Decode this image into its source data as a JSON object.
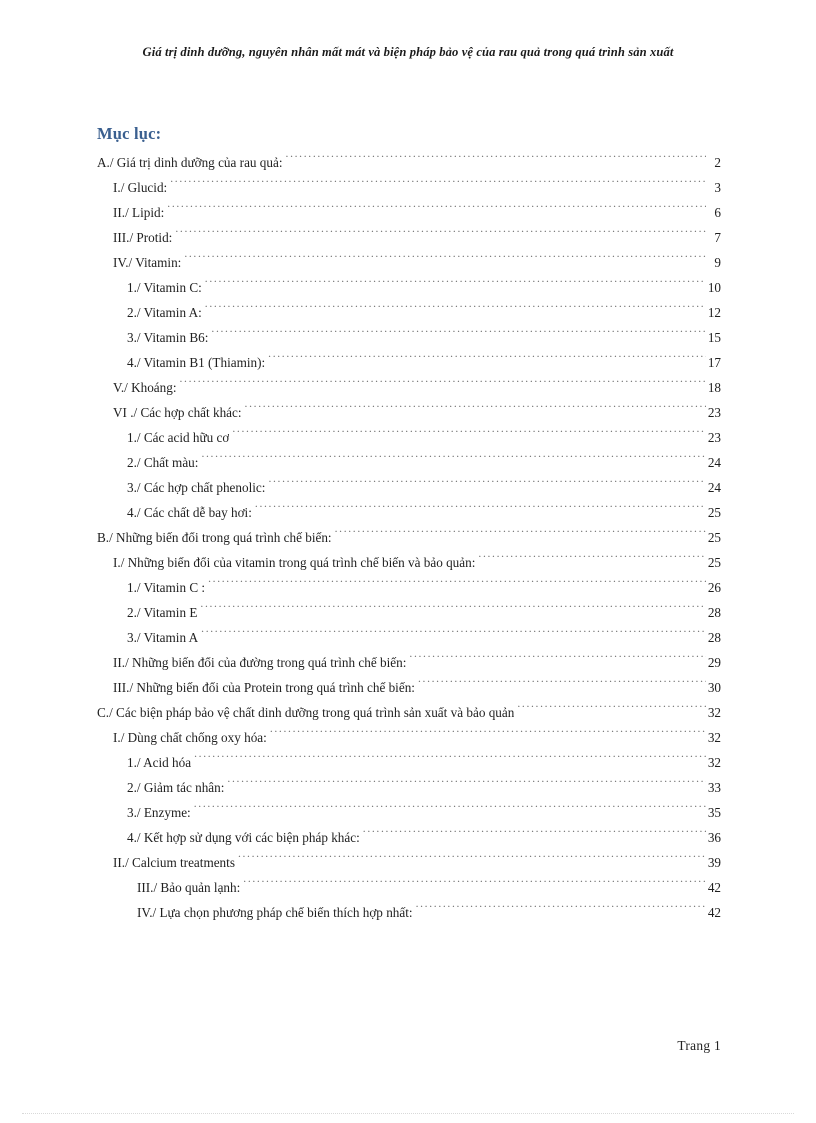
{
  "header": {
    "running_title": "Giá trị dinh dưỡng, nguyên nhân mất mát và biện pháp bảo vệ của rau quả trong quá trình sản xuất"
  },
  "toc": {
    "title": "Mục lục:",
    "entries": [
      {
        "level": 0,
        "label": "A./ Giá trị dinh  dưỡng của rau  quả:",
        "page": "2"
      },
      {
        "level": 1,
        "label": "I./ Glucid:",
        "page": "3"
      },
      {
        "level": 1,
        "label": "II./  Lipid:",
        "page": "6"
      },
      {
        "level": 1,
        "label": "III./ Protid:",
        "page": "7"
      },
      {
        "level": 1,
        "label": "IV./ Vitamin:",
        "page": "9"
      },
      {
        "level": 2,
        "label": "1./ Vitamin  C:",
        "page": "10"
      },
      {
        "level": 2,
        "label": "2./ Vitamin  A:",
        "page": "12"
      },
      {
        "level": 2,
        "label": "3./ Vitamin  B6:",
        "page": "15"
      },
      {
        "level": 2,
        "label": "4./ Vitamin  B1 (Thiamin):",
        "page": "17"
      },
      {
        "level": 1,
        "label": "V./ Khoáng:",
        "page": "18"
      },
      {
        "level": 1,
        "label": "VI ./ Các hợp  chất khác:",
        "page": "23"
      },
      {
        "level": 2,
        "label": "1./ Các acid hữu cơ",
        "page": "23"
      },
      {
        "level": 2,
        "label": "2./ Chất màu:",
        "page": "24"
      },
      {
        "level": 2,
        "label": "3./ Các hợp  chất phenolic:",
        "page": "24"
      },
      {
        "level": 2,
        "label": "4./ Các chất dễ bay hơi:",
        "page": "25"
      },
      {
        "level": 0,
        "label": "B./ Những biến  đổi trong  quá trình  chế biến:",
        "page": "25"
      },
      {
        "level": 1,
        "label": "I./ Những biến  đổi của vitamin  trong  quá trình  chế biến  và bảo quản:",
        "page": "25"
      },
      {
        "level": 2,
        "label": "1./ Vitamin  C :",
        "page": "26"
      },
      {
        "level": 2,
        "label": "2./ Vitamin  E",
        "page": "28"
      },
      {
        "level": 2,
        "label": "3./ Vitamin  A",
        "page": "28"
      },
      {
        "level": 1,
        "label": "II./  Những biến  đổi của đường trong quá trình  chế biến:",
        "page": "29"
      },
      {
        "level": 1,
        "label": "III./ Những biến  đổi của Protein  trong  quá trình  chế biến:",
        "page": "30"
      },
      {
        "level": 0,
        "label": "C./ Các biện  pháp bảo vệ chất dinh  dưỡng trong  quá trình  sản xuất  và bảo quản",
        "page": "32"
      },
      {
        "level": 1,
        "label": "I./ Dùng  chất chống  oxy hóa:",
        "page": "32"
      },
      {
        "level": 2,
        "label": "1./ Acid  hóa",
        "page": "32"
      },
      {
        "level": 2,
        "label": "2./ Giảm  tác nhân:",
        "page": "33"
      },
      {
        "level": 2,
        "label": "3./ Enzyme:",
        "page": "35"
      },
      {
        "level": 2,
        "label": "4./ Kết hợp sử dụng  với  các biện  pháp khác:",
        "page": "36"
      },
      {
        "level": 1,
        "label": "II./ Calcium  treatments",
        "page": "39"
      },
      {
        "level": 3,
        "label": "III./ Bảo quản lạnh:",
        "page": "42"
      },
      {
        "level": 3,
        "label": "IV./ Lựa chọn  phương  pháp chế biến  thích  hợp nhất:",
        "page": "42"
      }
    ]
  },
  "footer": {
    "page_label": "Trang  1"
  },
  "colors": {
    "heading_blue": "#3a5f8f",
    "body_text": "#1f1f1f",
    "leader_dots": "#6d6d6d",
    "bottom_rule": "#d9d9d9"
  }
}
